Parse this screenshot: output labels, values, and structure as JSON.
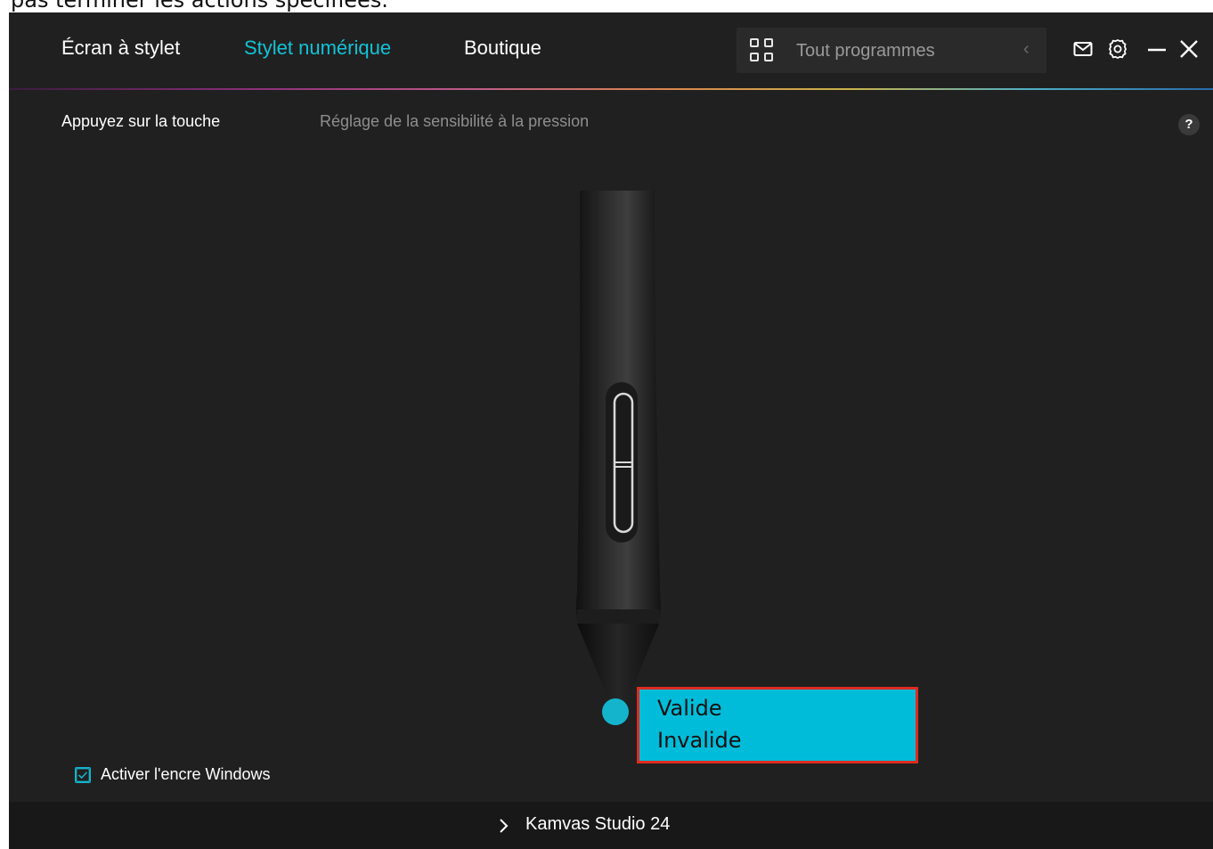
{
  "document": {
    "fragment_text": "pas terminer les actions spécifiées."
  },
  "header": {
    "tabs": [
      {
        "label": "Écran à stylet",
        "active": false
      },
      {
        "label": "Stylet numérique",
        "active": true
      },
      {
        "label": "Boutique",
        "active": false
      }
    ],
    "program_selector": {
      "label": "Tout programmes",
      "icon": "grid-icon",
      "arrow_icon": "chevron-left-icon"
    },
    "icons": [
      "mail-icon",
      "gear-icon",
      "minimize-icon",
      "close-icon"
    ]
  },
  "subtabs": [
    {
      "label": "Appuyez sur la touche",
      "active": true
    },
    {
      "label": "Réglage de la sensibilité à la pression",
      "active": false
    }
  ],
  "help": {
    "label": "?"
  },
  "pen": {
    "image": "stylus-pen-illustration",
    "tip_marker_color": "#14b4cc"
  },
  "dropdown": {
    "items": [
      "Valide",
      "Invalide"
    ],
    "highlight_color": "#00bcd9",
    "border_color": "#e02b20"
  },
  "windows_ink": {
    "label": "Activer l'encre Windows",
    "checked": true
  },
  "footer": {
    "device_label": "Kamvas Studio 24",
    "icon": "chevron-right-icon"
  },
  "colors": {
    "accent": "#12c3d6",
    "background": "#202020",
    "footer": "#181818"
  }
}
